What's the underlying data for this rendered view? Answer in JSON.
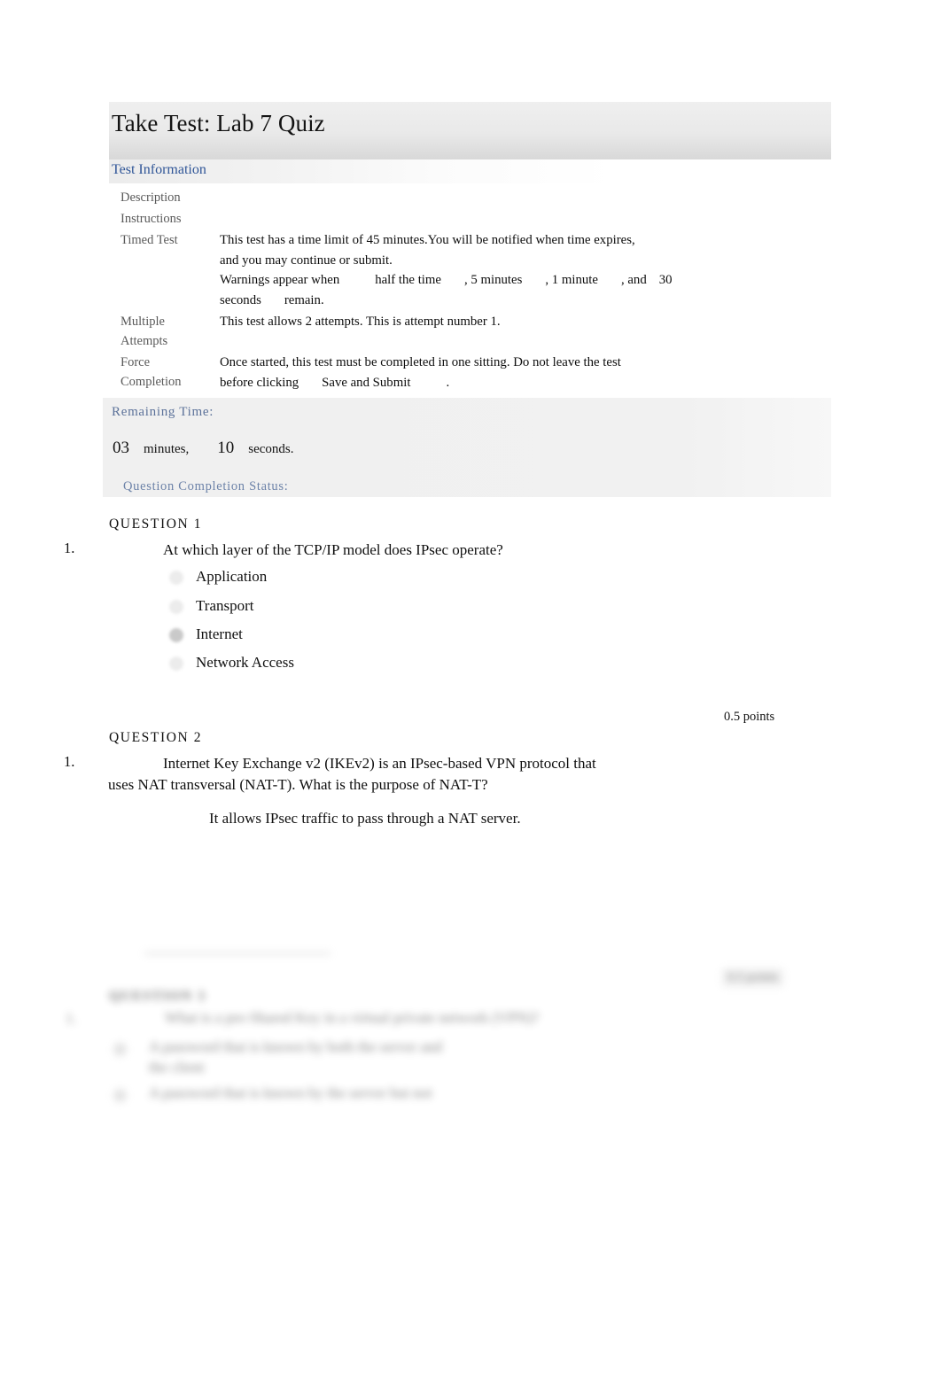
{
  "page": {
    "title": "Take Test: Lab 7 Quiz"
  },
  "test_information": {
    "section_label": "Test Information",
    "rows": [
      {
        "key": "Description",
        "value": ""
      },
      {
        "key": "Instructions",
        "value": ""
      },
      {
        "key": "Timed Test",
        "line1": "This test has a time limit of 45 minutes.You will be notified when time expires,",
        "line2": "and you may continue or submit.",
        "line3_a": "Warnings appear when",
        "line3_b": "half the time",
        "line3_c": ", 5 minutes",
        "line3_d": ", 1 minute",
        "line3_e": ", and",
        "line3_f": "30",
        "line4_a": "seconds",
        "line4_b": "remain."
      },
      {
        "key_line1": "Multiple",
        "key_line2": "Attempts",
        "value": "This test allows 2 attempts. This is attempt number 1."
      },
      {
        "key_line1": "Force",
        "key_line2": "Completion",
        "line1": "Once started, this test must be completed in one sitting. Do not leave the test",
        "line2_a": "before clicking",
        "line2_b": "Save and Submit",
        "line2_c": "."
      }
    ]
  },
  "timer": {
    "label": "Remaining Time:",
    "minutes": "03",
    "minutes_unit": "minutes,",
    "seconds": "10",
    "seconds_unit": "seconds.",
    "completion_status_label": "Question Completion Status:"
  },
  "questions": [
    {
      "heading": "QUESTION 1",
      "number": "1.",
      "text": "At which layer of the TCP/IP model does IPsec operate?",
      "points": "0.5 points",
      "options": [
        {
          "label": "Application",
          "selected": false
        },
        {
          "label": "Transport",
          "selected": false
        },
        {
          "label": "Internet",
          "selected": true
        },
        {
          "label": "Network Access",
          "selected": false
        }
      ]
    },
    {
      "heading": "QUESTION 2",
      "number": "1.",
      "text_line1": "Internet Key Exchange v2 (IKEv2) is an IPsec-based VPN protocol that",
      "text_line2": "uses NAT transversal (NAT-T). What is the purpose of NAT-T?",
      "answer": "It allows IPsec traffic to pass through a NAT server."
    }
  ],
  "obscured_section": {
    "note_points": "0.5 points",
    "note_heading": "QUESTION 3",
    "note_number": "1.",
    "note_text": "What is a pre-Shared Key in a virtual private network (VPN)?",
    "note_option_1_line1": "A password that is known by both the server and",
    "note_option_1_line2": "the client",
    "note_option_2": "A password that is known by the server but not"
  },
  "colors": {
    "heading_link_blue": "#2f5597",
    "timer_blue": "#5b7199",
    "header_gradient_top": "#efefef",
    "header_gradient_bottom": "#d8d8d8",
    "panel_gray": "#f0f0f0",
    "muted_key_gray": "#595959"
  }
}
